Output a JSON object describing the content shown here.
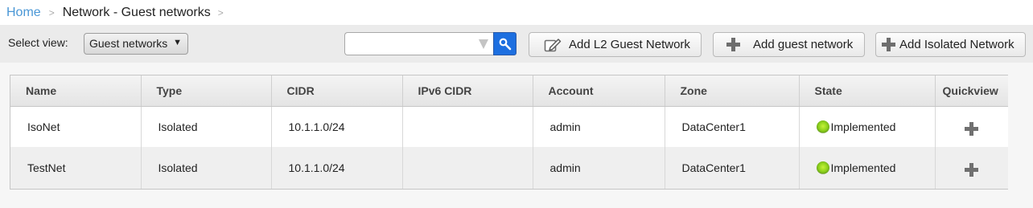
{
  "breadcrumb": {
    "home": "Home",
    "separator": ">",
    "current": "Network - Guest networks"
  },
  "toolbar": {
    "select_view_label": "Select view:",
    "select_view_value": "Guest networks",
    "search_placeholder": "",
    "add_l2_label": "Add L2 Guest Network",
    "add_guest_label": "Add guest network",
    "add_isolated_label": "Add Isolated Network"
  },
  "table": {
    "columns": [
      "Name",
      "Type",
      "CIDR",
      "IPv6 CIDR",
      "Account",
      "Zone",
      "State",
      "Quickview"
    ],
    "rows": [
      {
        "name": "IsoNet",
        "type": "Isolated",
        "cidr": "10.1.1.0/24",
        "ipv6_cidr": "",
        "account": "admin",
        "zone": "DataCenter1",
        "state": "Implemented"
      },
      {
        "name": "TestNet",
        "type": "Isolated",
        "cidr": "10.1.1.0/24",
        "ipv6_cidr": "",
        "account": "admin",
        "zone": "DataCenter1",
        "state": "Implemented"
      }
    ]
  },
  "colors": {
    "link": "#4a97d6",
    "search_button": "#1d6fe0",
    "state_text": "#2c8a1a",
    "state_dot": "#8fd31c"
  },
  "icons": [
    "chevron-right-icon",
    "dropdown-arrow-icon",
    "filter-icon",
    "search-icon",
    "edit-icon",
    "plus-icon"
  ]
}
